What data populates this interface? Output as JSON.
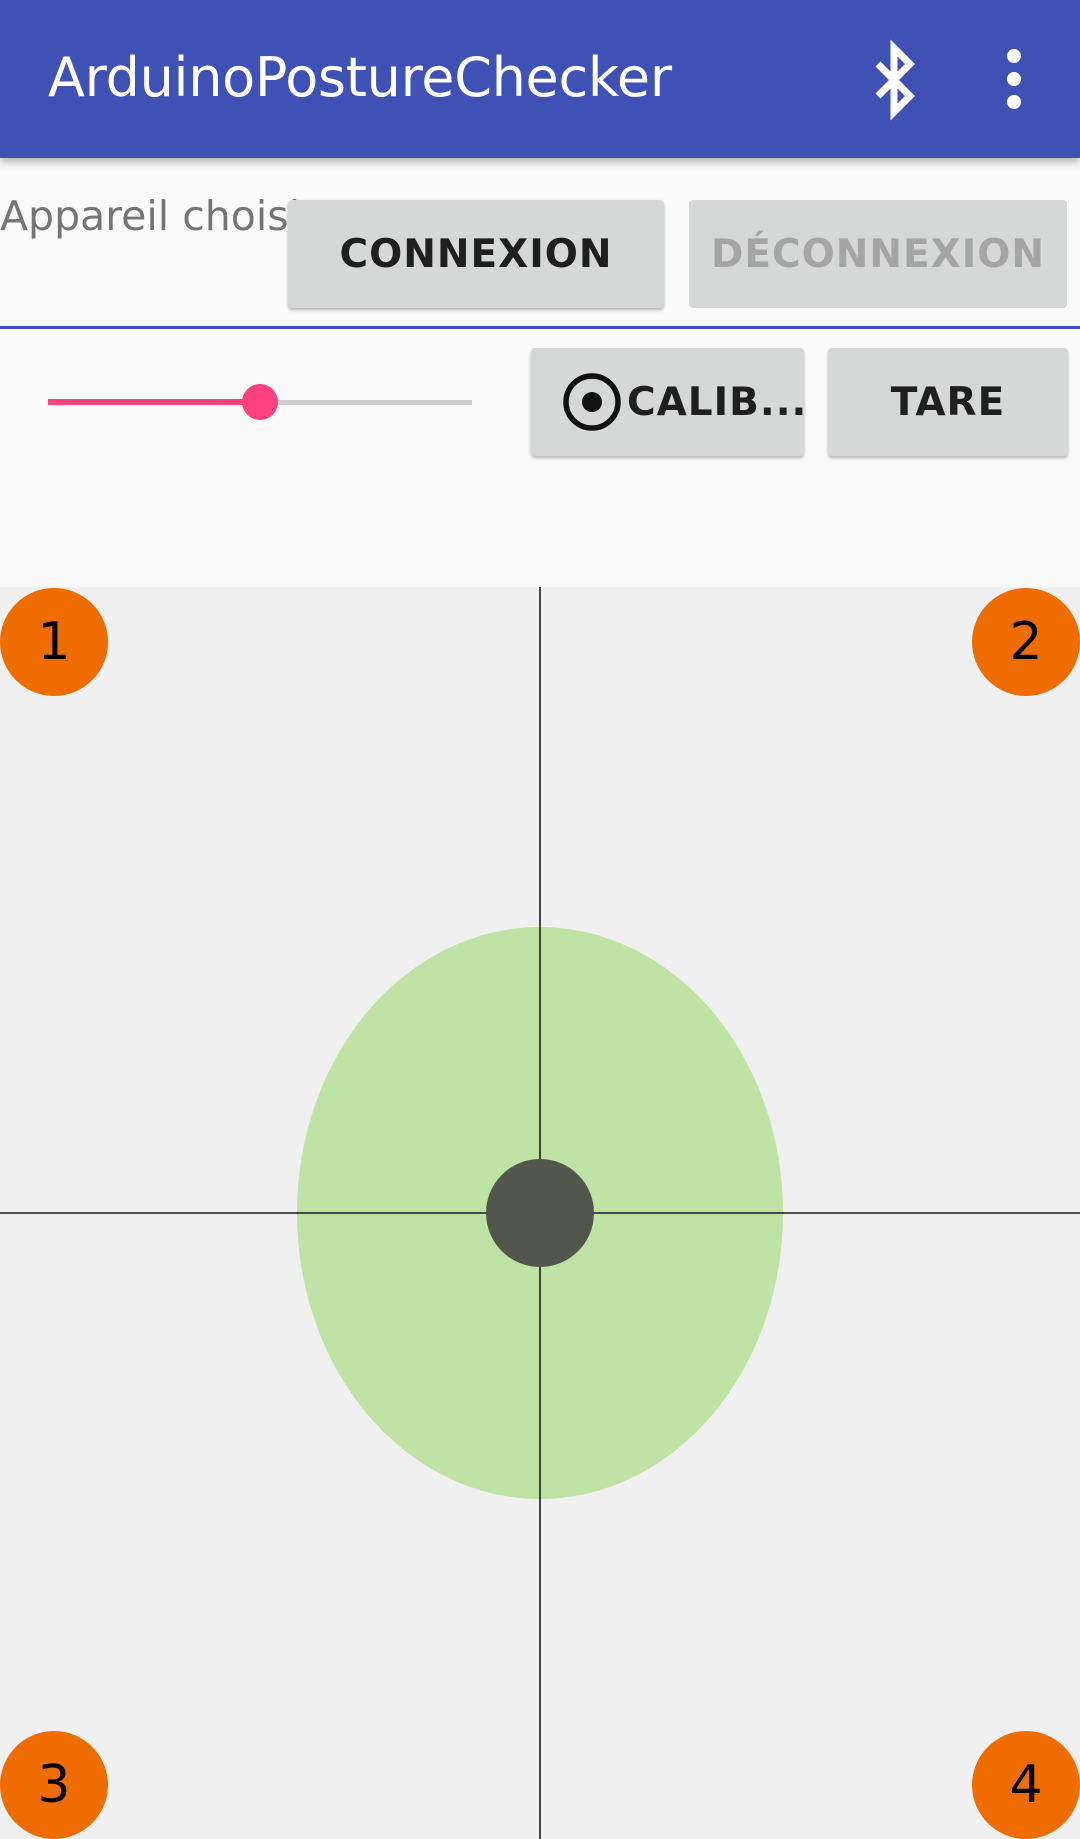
{
  "app_bar": {
    "title": "ArduinoPostureChecker",
    "background_color": "#3f51b5",
    "icons": [
      "bluetooth-icon",
      "more-vert-icon"
    ]
  },
  "connection": {
    "device_label": "Appareil choisi",
    "connect_label": "CONNEXION",
    "disconnect_label": "DÉCONNEXION",
    "disconnect_enabled": false
  },
  "controls": {
    "slider_value": 0.5,
    "slider_color": "#ff4081",
    "calibrate_label": "CALIB...",
    "calibrate_icon": "radio-target-icon",
    "tare_label": "TARE"
  },
  "posture_view": {
    "corners": [
      "1",
      "2",
      "3",
      "4"
    ],
    "corner_color": "#ef6c00",
    "zone_color": "#bee3a4",
    "indicator_color": "#53564c",
    "background_color": "#f0f0f0"
  }
}
